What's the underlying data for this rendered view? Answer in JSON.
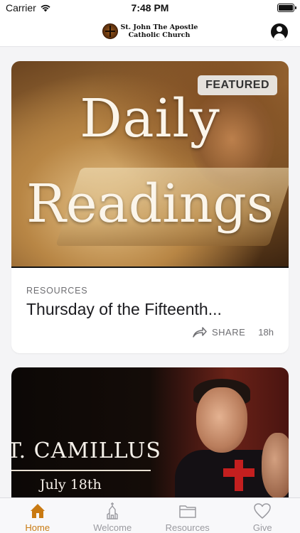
{
  "status_bar": {
    "carrier": "Carrier",
    "time": "7:48 PM"
  },
  "header": {
    "logo_line1": "St. John The Apostle",
    "logo_line2": "Catholic Church",
    "profile_icon": "person-circle-icon"
  },
  "feed": {
    "cards": [
      {
        "image_text_line1": "Daily",
        "image_text_line2": "Readings",
        "badge": "FEATURED",
        "category": "RESOURCES",
        "title": "Thursday of the Fifteenth...",
        "share_label": "SHARE",
        "timestamp": "18h"
      },
      {
        "image_text_line1": "T. CAMILLUS",
        "image_text_line2": "July 18th"
      }
    ]
  },
  "tab_bar": {
    "active_color": "#c97a12",
    "inactive_color": "#9a9aa0",
    "tabs": [
      {
        "label": "Home",
        "icon": "house-icon",
        "active": true
      },
      {
        "label": "Welcome",
        "icon": "church-icon",
        "active": false
      },
      {
        "label": "Resources",
        "icon": "folder-icon",
        "active": false
      },
      {
        "label": "Give",
        "icon": "heart-icon",
        "active": false
      }
    ]
  }
}
